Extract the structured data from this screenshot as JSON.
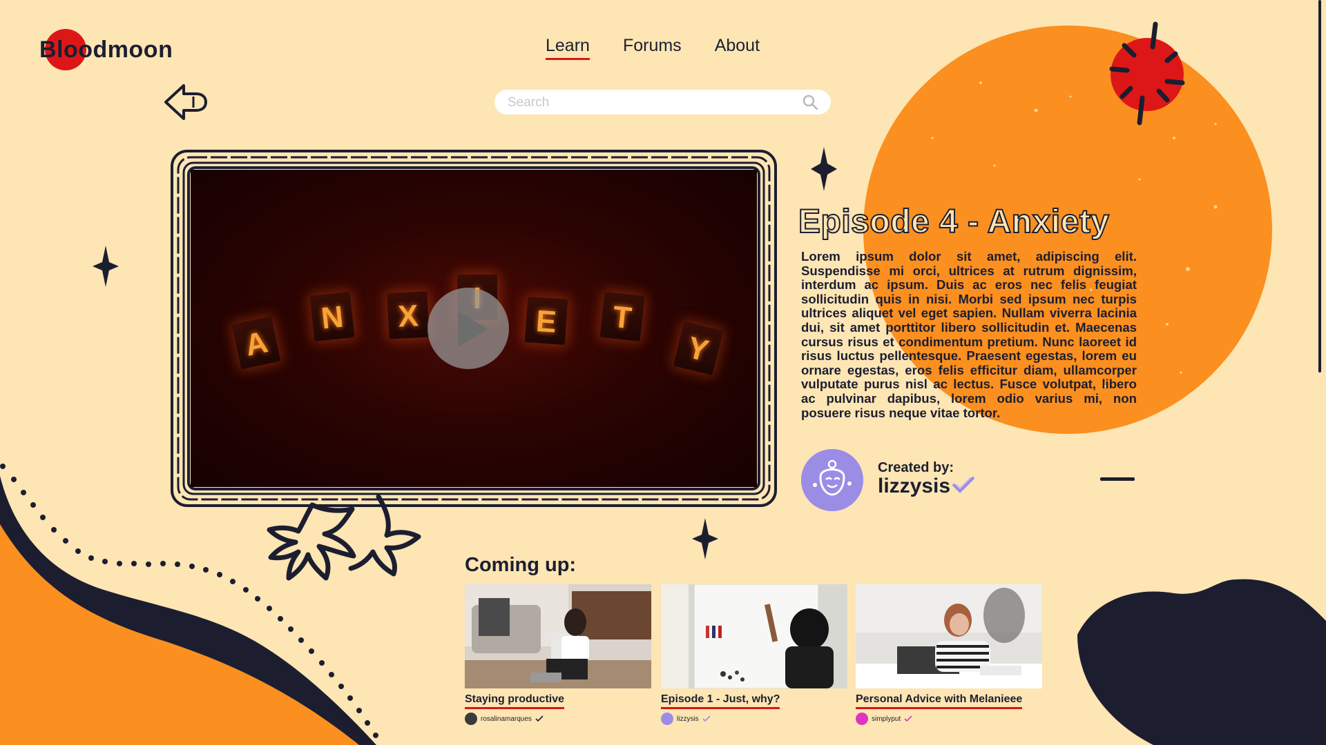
{
  "brand": {
    "name": "Bloodmoon"
  },
  "nav": {
    "items": [
      {
        "label": "Learn",
        "active": true
      },
      {
        "label": "Forums",
        "active": false
      },
      {
        "label": "About",
        "active": false
      }
    ]
  },
  "search": {
    "placeholder": "Search",
    "icon": "search-icon"
  },
  "video": {
    "tiles": [
      {
        "letter": "A"
      },
      {
        "letter": "N"
      },
      {
        "letter": "X"
      },
      {
        "letter": "I"
      },
      {
        "letter": "E"
      },
      {
        "letter": "T"
      },
      {
        "letter": "Y"
      }
    ],
    "play_icon": "play-icon"
  },
  "episode": {
    "title": "Episode 4 - Anxiety",
    "description": "Lorem ipsum dolor sit amet, adipiscing elit. Suspendisse mi orci, ultrices at rutrum dignissim, interdum ac ipsum. Duis ac eros nec felis feugiat sollicitudin quis in nisi. Morbi sed ipsum nec turpis ultrices aliquet vel eget sapien. Nullam viverra lacinia dui, sit amet porttitor libero sollicitudin et. Maecenas cursus risus et condimentum pretium. Nunc laoreet id risus luctus pellentesque. Praesent egestas, lorem eu ornare egestas, eros felis efficitur diam, ullamcorper vulputate purus nisl ac lectus. Fusce volutpat, libero ac pulvinar dapibus, lorem odio varius mi, non posuere risus neque vitae tortor.",
    "created_by_label": "Created by:",
    "creator": "lizzysis"
  },
  "coming_up": {
    "title": "Coming up:",
    "cards": [
      {
        "title": "Staying productive",
        "author": "rosalinamarques"
      },
      {
        "title": "Episode 1 - Just, why?",
        "author": "lizzysis"
      },
      {
        "title": "Personal Advice with Melanieee",
        "author": "simplyput"
      }
    ]
  },
  "colors": {
    "background": "#fde5b4",
    "orange": "#fb8f1f",
    "navy": "#1c1e30",
    "red": "#dd1717",
    "purple": "#9b8ce6",
    "pink": "#e033c0"
  }
}
